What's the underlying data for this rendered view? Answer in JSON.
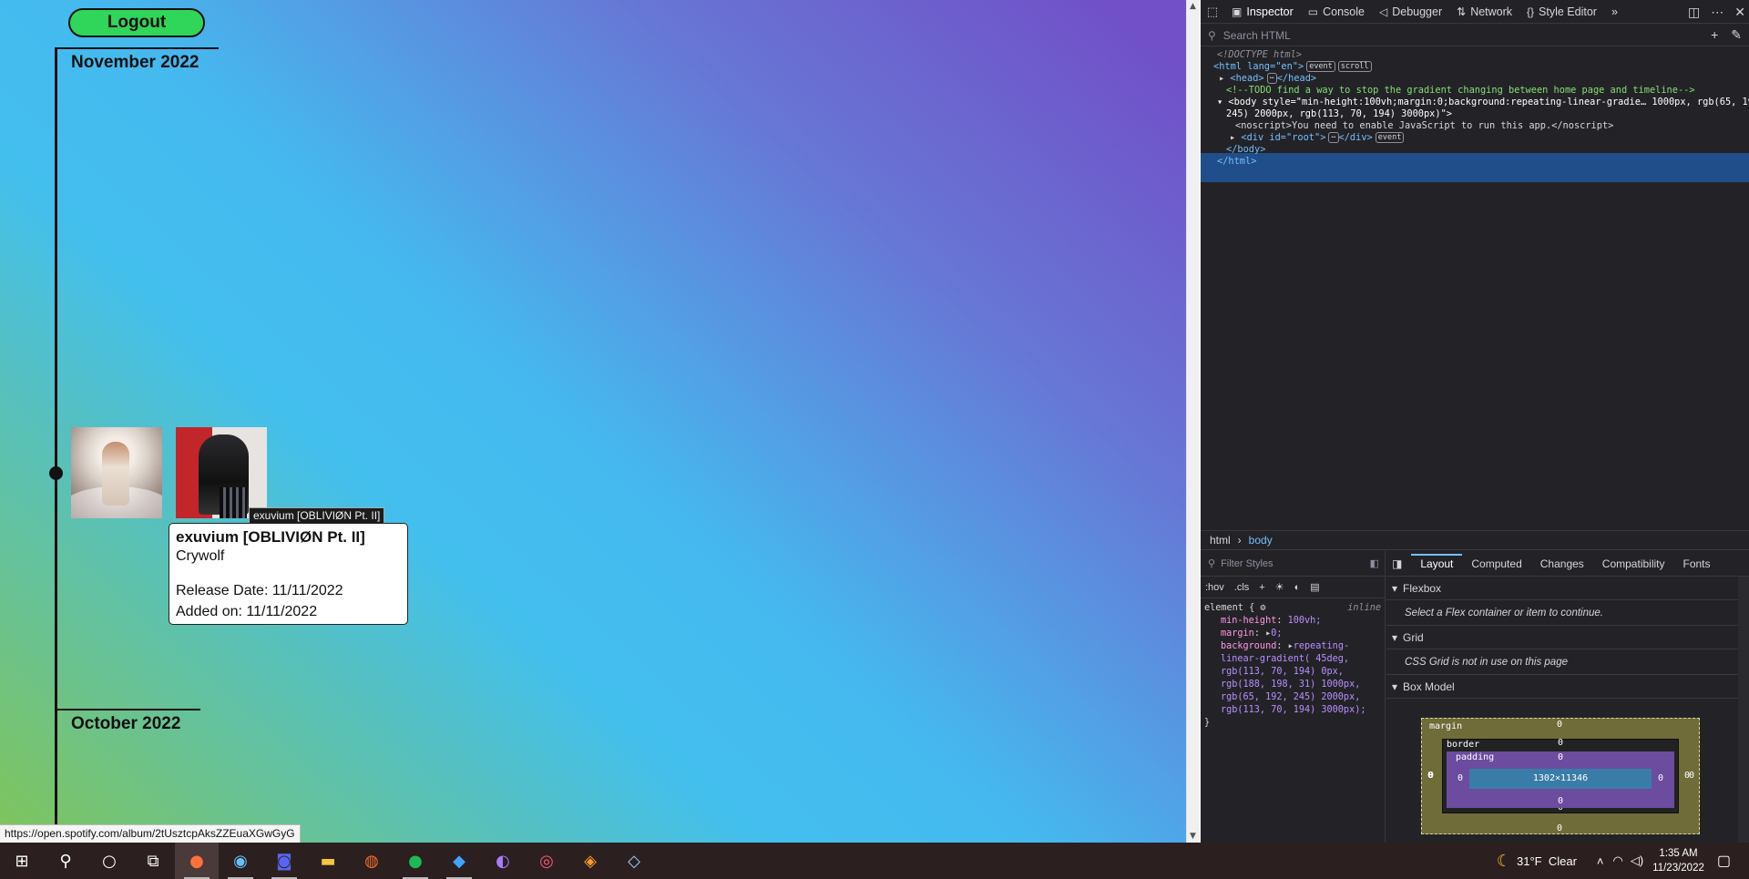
{
  "page": {
    "logout_label": "Logout",
    "months": [
      "November 2022",
      "October 2022"
    ],
    "album_tooltip": "exuvium [OBLIVIØN Pt. II]",
    "album_card": {
      "title": "exuvium [OBLIVIØN Pt. II]",
      "artist": "Crywolf",
      "release": "Release Date: 11/11/2022",
      "added": "Added on: 11/11/2022"
    },
    "status_url": "https://open.spotify.com/album/2tUsztcpAksZZEuaXGwGyG"
  },
  "devtools": {
    "tabs": [
      {
        "label": "Inspector",
        "icon": "inspector-icon"
      },
      {
        "label": "Console",
        "icon": "console-icon"
      },
      {
        "label": "Debugger",
        "icon": "debugger-icon"
      },
      {
        "label": "Network",
        "icon": "network-icon"
      },
      {
        "label": "Style Editor",
        "icon": "style-editor-icon"
      }
    ],
    "search_placeholder": "Search HTML",
    "markup": {
      "doctype": "<!DOCTYPE html>",
      "html_open": "<html lang=\"en\">",
      "head": "<head>",
      "head_close": "</head>",
      "comment": "<!--TODO find a way to stop the gradient changing between home page and timeline-->",
      "body_line1": "<body style=\"min-height:100vh;margin:0;background:repeating-linear-gradie… 1000px, rgb(65, 192,",
      "body_line2": "245) 2000px, rgb(113, 70, 194) 3000px)\">",
      "noscript": "<noscript>You need to enable JavaScript to run this app.</noscript>",
      "div_root": "<div id=\"root\">",
      "div_close": "</div>",
      "body_close": "</body>",
      "html_close": "</html>",
      "badges": [
        "event",
        "scroll",
        "event"
      ]
    },
    "breadcrumbs": [
      "html",
      "body"
    ],
    "styles": {
      "filter_placeholder": "Filter Styles",
      "tools": [
        ":hov",
        ".cls"
      ],
      "selector": "element {",
      "inline_label": "inline",
      "props": [
        {
          "name": "min-height",
          "value": "100vh;"
        },
        {
          "name": "margin",
          "value": "0;"
        },
        {
          "name": "background",
          "value": "repeating-linear-gradient( 45deg, rgb(113, 70, 194) 0px, rgb(188, 198, 31) 1000px, rgb(65, 192, 245) 2000px, rgb(113, 70, 194) 3000px);"
        }
      ],
      "close": "}"
    },
    "layout": {
      "tabs": [
        "Layout",
        "Computed",
        "Changes",
        "Compatibility",
        "Fonts"
      ],
      "flexbox_title": "Flexbox",
      "flexbox_note": "Select a Flex container or item to continue.",
      "grid_title": "Grid",
      "grid_note": "CSS Grid is not in use on this page",
      "boxmodel_title": "Box Model",
      "boxmodel": {
        "margin_label": "margin",
        "border_label": "border",
        "padding_label": "padding",
        "content_size": "1302×11346",
        "zero": "0"
      }
    }
  },
  "taskbar": {
    "weather": "31°F  Clear",
    "time": "1:35 AM",
    "date": "11/23/2022"
  }
}
